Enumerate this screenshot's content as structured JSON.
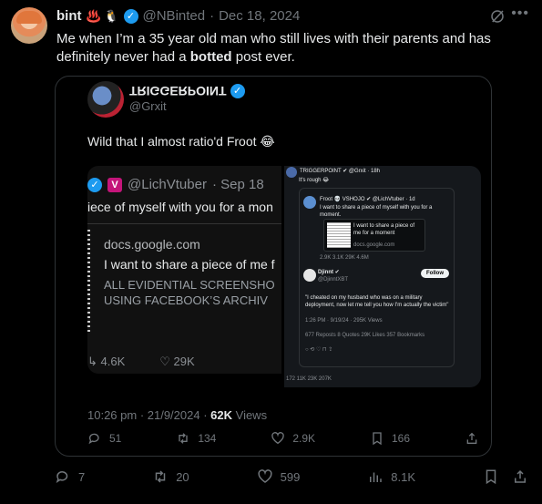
{
  "post": {
    "display_name": "bint",
    "name_emojis": "♨️ 🐧",
    "handle": "@NBinted",
    "separator": "·",
    "date": "Dec 18, 2024",
    "text_before": "Me when I’m a 35 year old man who still lives with their parents and has definitely never had a ",
    "text_bold": "botted",
    "text_after": " post ever.",
    "actions": {
      "replies": "7",
      "reposts": "20",
      "likes": "599",
      "views": "8.1K"
    }
  },
  "quoted": {
    "display_name": "TRIGGERPOINT",
    "handle": "@Grxit",
    "text": "Wild that I almost ratio'd Froot 😂",
    "timestamp": "10:26 pm · 21/9/2024 · ",
    "views_count": "62K",
    "views_label": " Views",
    "actions": {
      "replies": "51",
      "reposts": "134",
      "likes": "2.9K",
      "bookmarks": "166"
    }
  },
  "image_left": {
    "handle": "@LichVtuber",
    "date": "· Sep 18",
    "line": "iece of myself with you for a mon",
    "domain": "docs.google.com",
    "title": "I want to share a piece of me f",
    "body1": "ALL EVIDENTIAL SCREENSHO",
    "body2": "USING FACEBOOK’S ARCHIV",
    "reposts": "4.6K",
    "likes": "29K"
  },
  "image_right": {
    "header": "TRIGGERPOINT ✔ @Grxit · 18h",
    "sub": "It's rough 😂",
    "froot_name": "Froot 💀 VSHOJO ✔ @LichVtuber · 1d",
    "froot_text": "I want to share a piece of myself with you for a moment.",
    "doc_title": "I want to share a piece of me for a moment",
    "doc_domain": "docs.google.com",
    "froot_stats": "2.9K   3.1K   29K   4.6M",
    "djinnt_name": "Djinnt ✔",
    "djinnt_handle": "@DjinntXBT",
    "follow": "Follow",
    "djinnt_quote": "\"I cheated on my husband who was on a military deployment, now let me tell you how I'm actually the victim\"",
    "meta": "1:26 PM · 9/19/24 · 295K Views",
    "engage": "677 Reposts  8 Quotes  29K Likes  357 Bookmarks",
    "acts": "○  ⟲  ♡  ⊓  ⇪",
    "acts2": "172   11K   23K   207K"
  }
}
